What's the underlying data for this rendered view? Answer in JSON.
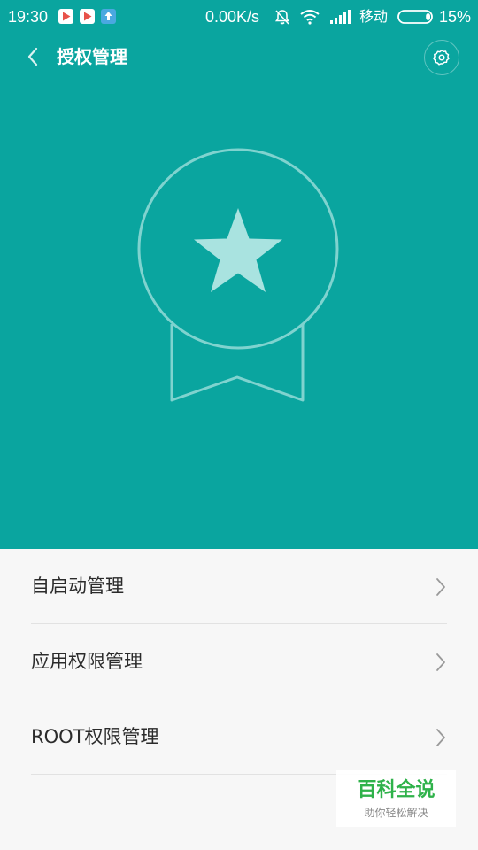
{
  "status_bar": {
    "time": "19:30",
    "network_speed": "0.00K/s",
    "carrier": "移动",
    "battery_percent": "15%",
    "battery_level": 0.15,
    "icons": [
      "video-app-icon",
      "video-app-icon",
      "upload-icon",
      "silent-bell-icon",
      "wifi-icon",
      "signal-icon",
      "battery-icon"
    ]
  },
  "app_bar": {
    "title": "授权管理",
    "back_icon": "chevron-left-icon",
    "settings_icon": "gear-icon"
  },
  "hero": {
    "background_color": "#0aa59f",
    "illustration": "star-medal-badge"
  },
  "menu": {
    "items": [
      {
        "label": "自启动管理",
        "icon": "chevron-right-icon"
      },
      {
        "label": "应用权限管理",
        "icon": "chevron-right-icon"
      },
      {
        "label": "ROOT权限管理",
        "icon": "chevron-right-icon"
      }
    ]
  },
  "watermark": {
    "main": "百科全说",
    "sub": "助你轻松解决"
  }
}
